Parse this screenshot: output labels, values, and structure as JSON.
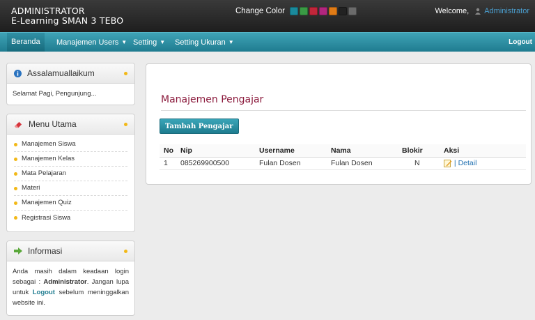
{
  "header": {
    "role": "ADMINISTRATOR",
    "site_name": "E-Learning SMAN 3 TEBO",
    "change_color_label": "Change Color",
    "welcome_label": "Welcome,",
    "username": "Administrator"
  },
  "swatches": [
    "#1a8a9c",
    "#3a9a45",
    "#c2263a",
    "#b2267e",
    "#e07b16",
    "#222222",
    "#6b6b6b"
  ],
  "nav": {
    "items": [
      {
        "label": "Beranda"
      },
      {
        "label": "Manajemen Users"
      },
      {
        "label": "Setting"
      },
      {
        "label": "Setting Ukuran"
      }
    ],
    "logout_label": "Logout"
  },
  "sidebar": {
    "greeting": {
      "title": "Assalamuallaikum",
      "text": "Selamat Pagi, Pengunjung..."
    },
    "menu": {
      "title": "Menu Utama",
      "items": [
        {
          "label": "Manajemen Siswa"
        },
        {
          "label": "Manajemen Kelas"
        },
        {
          "label": "Mata Pelajaran"
        },
        {
          "label": "Materi"
        },
        {
          "label": "Manajemen Quiz"
        },
        {
          "label": "Registrasi Siswa"
        }
      ]
    },
    "info": {
      "title": "Informasi",
      "line1": "Anda masih dalam keadaan login sebagai :",
      "user": "Administrator",
      "line2": "Jangan lupa untuk",
      "logout_link": "Logout",
      "line3": "sebelum meninggalkan website ini."
    }
  },
  "main": {
    "title": "Manajemen Pengajar",
    "add_button": "Tambah Pengajar",
    "columns": [
      "No",
      "Nip",
      "Username",
      "Nama",
      "Blokir",
      "Aksi"
    ],
    "rows": [
      {
        "no": "1",
        "nip": "085269900500",
        "username": "Fulan Dosen",
        "nama": "Fulan Dosen",
        "blokir": "N",
        "detail": "| Detail"
      }
    ]
  }
}
